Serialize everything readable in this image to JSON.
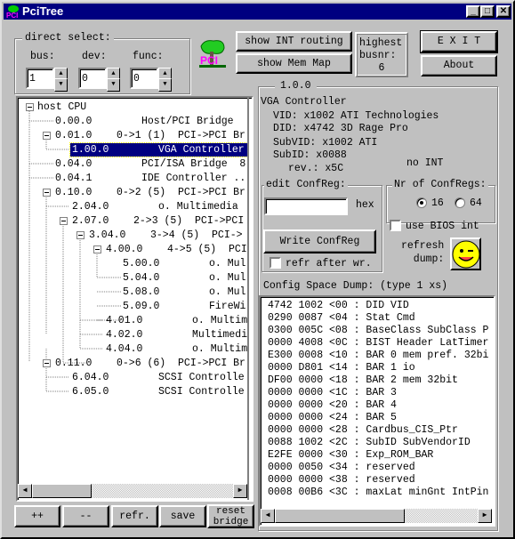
{
  "window": {
    "title": "PciTree",
    "min": "_",
    "max": "□",
    "close": "✕"
  },
  "direct_select": {
    "label": "direct select:",
    "bus_label": "bus:",
    "dev_label": "dev:",
    "func_label": "func:",
    "bus": "1",
    "dev": "0",
    "func": "0"
  },
  "logo_text": "PCI",
  "buttons": {
    "int_routing": "show INT routing",
    "mem_map": "show Mem Map",
    "exit": "E X I T",
    "about": "About"
  },
  "highest_busnr": {
    "label": "highest\nbusnr:",
    "value": "6"
  },
  "tree": {
    "root": "host CPU",
    "rows": [
      {
        "id": "0.00.0",
        "desc": "Host/PCI Bridge"
      },
      {
        "id": "0.01.0",
        "desc": "0->1 (1)  PCI->PCI Br"
      },
      {
        "id": "1.00.0",
        "desc": "VGA Controller"
      },
      {
        "id": "0.04.0",
        "desc": "PCI/ISA Bridge  8"
      },
      {
        "id": "0.04.1",
        "desc": "IDE Controller .."
      },
      {
        "id": "0.10.0",
        "desc": "0->2 (5)  PCI->PCI Br"
      },
      {
        "id": "2.04.0",
        "desc": "o. Multimedia"
      },
      {
        "id": "2.07.0",
        "desc": "2->3 (5)  PCI->PCI"
      },
      {
        "id": "3.04.0",
        "desc": "3->4 (5)  PCI->"
      },
      {
        "id": "4.00.0",
        "desc": "4->5 (5)  PCI"
      },
      {
        "id": "5.00.0",
        "desc": "o. Mul"
      },
      {
        "id": "5.04.0",
        "desc": "o. Mul"
      },
      {
        "id": "5.08.0",
        "desc": "o. Mul"
      },
      {
        "id": "5.09.0",
        "desc": "FireWi"
      },
      {
        "id": "4.01.0",
        "desc": "o. Multim"
      },
      {
        "id": "4.02.0",
        "desc": "Multimedi"
      },
      {
        "id": "4.04.0",
        "desc": "o. Multim"
      },
      {
        "id": "0.11.0",
        "desc": "0->6 (6)  PCI->PCI Br"
      },
      {
        "id": "6.04.0",
        "desc": "SCSI Controlle"
      },
      {
        "id": "6.05.0",
        "desc": "SCSI Controlle"
      }
    ]
  },
  "bottom_buttons": {
    "inc": "++",
    "dec": "--",
    "refr": "refr.",
    "save": "save",
    "reset": "reset\nbridge"
  },
  "device": {
    "group_label": "1.0.0",
    "name": "VGA Controller",
    "vid": "VID: x1002 ATI Technologies",
    "did": "DID: x4742  3D Rage Pro",
    "subvid": "SubVID: x1002 ATI",
    "subid": "SubID:  x0088",
    "rev": "rev.: x5C",
    "int": "no INT"
  },
  "edit": {
    "label": "edit ConfReg:",
    "value": "",
    "hex": "hex",
    "write": "Write ConfReg",
    "refr_after": "refr after wr.",
    "refr_after_checked": false
  },
  "nr_confregs": {
    "label": "Nr of ConfRegs:",
    "opt16": "16",
    "opt64": "64",
    "selected": "16"
  },
  "bios": {
    "label": "use BIOS int",
    "checked": false
  },
  "refresh": {
    "label": "refresh\ndump:"
  },
  "dump": {
    "label": "Config Space Dump: (type 1 xs)",
    "lines": [
      "4742 1002 <00 : DID VID",
      "0290 0087 <04 : Stat Cmd",
      "0300 005C <08 : BaseClass SubClass P",
      "0000 4008 <0C : BIST Header LatTimer",
      "E300 0008 <10 : BAR 0 mem pref. 32bi",
      "0000 D801 <14 : BAR 1 io",
      "DF00 0000 <18 : BAR 2 mem 32bit",
      "0000 0000 <1C : BAR 3",
      "0000 0000 <20 : BAR 4",
      "0000 0000 <24 : BAR 5",
      "0000 0000 <28 : Cardbus_CIS_Ptr",
      "0088 1002 <2C : SubID SubVendorID",
      "E2FE 0000 <30 : Exp_ROM_BAR",
      "0000 0050 <34 : reserved",
      "0000 0000 <38 : reserved",
      "0008 00B6 <3C : maxLat minGnt IntPin"
    ]
  }
}
